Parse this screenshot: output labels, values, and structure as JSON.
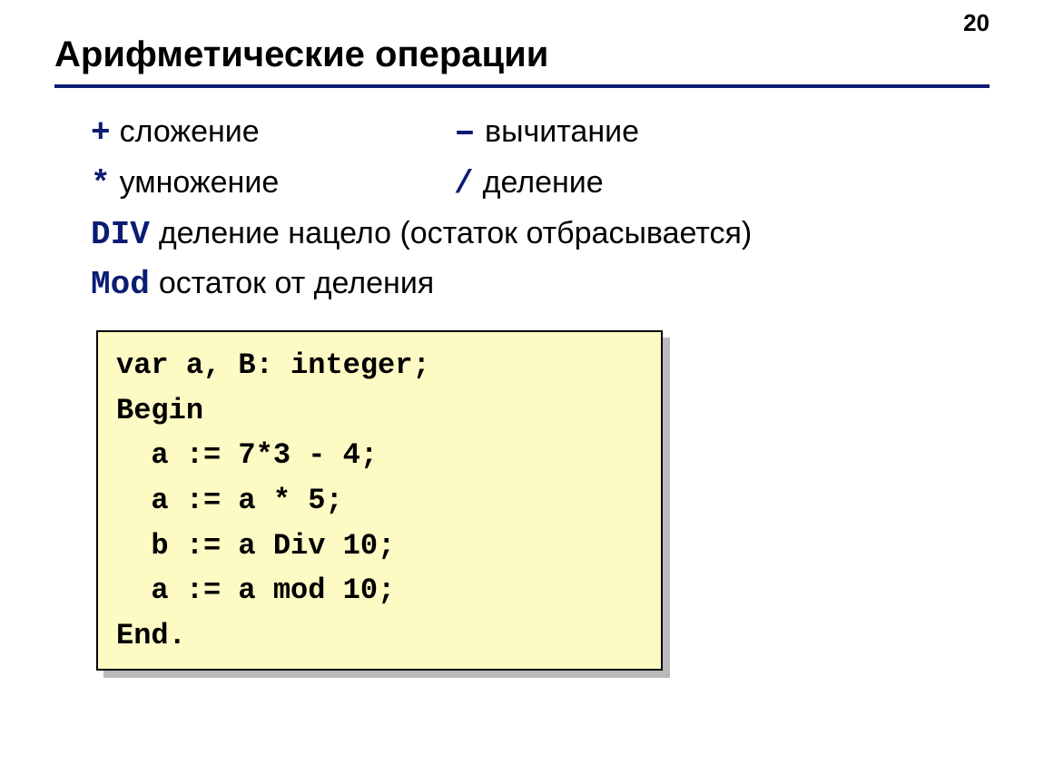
{
  "page_number": "20",
  "title": "Арифметические операции",
  "ops": {
    "plus": {
      "sym": "+",
      "label": "сложение"
    },
    "minus": {
      "sym": "–",
      "label": "вычитание"
    },
    "mul": {
      "sym": "*",
      "label": "умножение"
    },
    "div": {
      "sym": "/",
      "label": "деление"
    },
    "idiv": {
      "sym": "DIV",
      "label": "деление нацело (остаток отбрасывается)"
    },
    "mod": {
      "sym": "Mod",
      "label": "остаток от деления"
    }
  },
  "code": {
    "l1": "var a, B: integer;",
    "l2": "Begin",
    "l3": "  a := 7*3 - 4;",
    "l4": "  a := a * 5;",
    "l5": "  b := a Div 10;",
    "l6": "  a := a mod 10;",
    "l7": "End."
  }
}
